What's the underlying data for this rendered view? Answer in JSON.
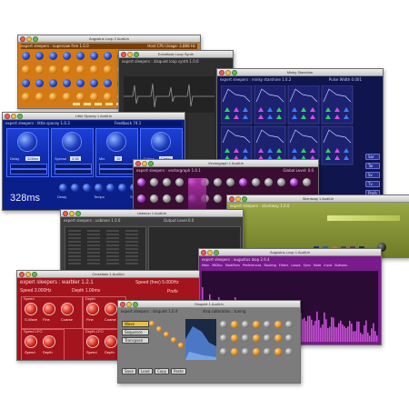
{
  "windows": {
    "supersawyer": {
      "title": "Augustus Loop 2 AudiUn",
      "subtitle": "expert sleepers : supersaw free 1.0.0",
      "subtitle_right": "Host CPU Usage: 3,888  Hz"
    },
    "echo": {
      "title": "Echoflode Loop Synth",
      "subtitle": "expert sleepers : disquiet loop synth 1.0.0",
      "footer": "SYNTHESIS MIXER"
    },
    "minky": {
      "title": "Minky Starshine",
      "subtitle": "expert sleepers : minky starshine 1.0.2",
      "pulse_label": "Pulse Width",
      "pulse_value": "0.001",
      "side_buttons": [
        "Sar",
        "Tar",
        "Sv",
        "Tv",
        "Prefs"
      ]
    },
    "little": {
      "title": "Little Spacey 1 AudiUn",
      "subtitle": "expert sleepers : little spacey 1.0.3",
      "feedback_label": "Feedback",
      "feedback_value": "74.1",
      "tail_label": "Feedback",
      "delay_readout": "328ms",
      "bottom_labels": [
        "Delay",
        "Tempo",
        "Sync"
      ],
      "params": [
        {
          "label": "Delay",
          "value": "328ms"
        },
        {
          "label": "Spread",
          "value": "3.56"
        },
        {
          "label": "Mix",
          "value": "15"
        },
        {
          "label": "Colour",
          "value": "Cmbp"
        }
      ]
    },
    "midi": {
      "title": "Vectorgraph 1 AudiUn",
      "subtitle": "expert sleepers : vectorgraph 1.0.1",
      "subtitle_right": "Global Level: 0.0"
    },
    "silent": {
      "title": "Silentway 1 AudiUn",
      "subtitle": "expert sleepers : silentway 1.0.0"
    },
    "gray": {
      "title": "Usbmon 1 AudiUn",
      "subtitle": "expert sleepers : usbmon 1.0.0",
      "right": "Output Level  0.0"
    },
    "purple": {
      "title": "Augustus Loop 1 AudiUn",
      "subtitle": "expert sleepers : augustus loop 2.6.4",
      "tabs": [
        "Main",
        "MIDIsc",
        "Modifiers",
        "Preferences",
        "Routing",
        "Filters",
        "Loops",
        "Sync",
        "Note",
        "Input",
        "Buttons"
      ]
    },
    "red": {
      "title": "Crossfade 1 AudiUn",
      "subtitle": "expert sleepers : warbler 1.2.1",
      "speed_label": "Speed",
      "speed_value": "3.000Hz",
      "speed_free_label": "Speed (free)",
      "speed_free_value": "5.000Hz",
      "depth_label": "Depth",
      "depth_value": "1.00ms",
      "prefs": "Prefs",
      "groups": [
        {
          "title": "Speed",
          "labels": [
            "S-Wave",
            "Fine",
            "Coarse"
          ]
        },
        {
          "title": "Depth",
          "labels": [
            "Fine",
            "Coarse"
          ]
        },
        {
          "title": "Speed LFO",
          "labels": [
            "Speed",
            "Depth"
          ]
        },
        {
          "title": "Depth LFO",
          "labels": [
            "Speed",
            "Depth"
          ]
        }
      ]
    },
    "bottomgray": {
      "title": "Disquiet 1 AudiUn",
      "subtitle": "expert sleepers : disquiet 1.0.4",
      "subtitle_right": "disq calibration : tuning",
      "left_buttons": [
        "Wave",
        "Sequence",
        "Transpose"
      ],
      "footer_buttons": [
        "Save",
        "Load",
        "Copy",
        "Paste"
      ]
    }
  },
  "colors": {
    "blue": "#0a1f8a",
    "orange": "#d37a16",
    "navy": "#11154d",
    "darkpurple": "#3a0e33",
    "olive": "#8c9a3a",
    "darkgray": "#4b4b4b",
    "magenta": "#8a1ea0",
    "crimson": "#a3141c",
    "midgray": "#8b8b8b"
  }
}
